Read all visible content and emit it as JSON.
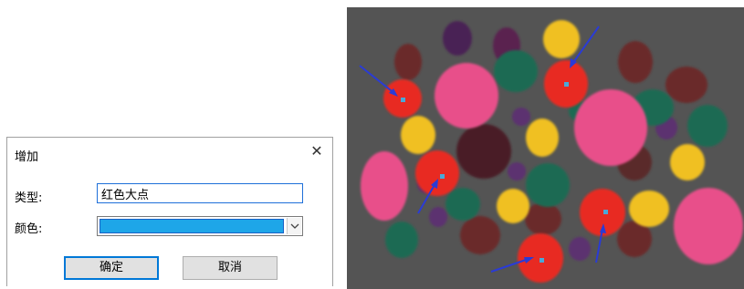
{
  "dialog": {
    "title": "增加",
    "close_icon": "close-icon",
    "type_label": "类型:",
    "type_value": "红色大点",
    "color_label": "颜色:",
    "color_value": "#1ea6e8",
    "ok_label": "确定",
    "cancel_label": "取消"
  },
  "image": {
    "description_icon": "dots-image",
    "marker_color": "#2a3bd6",
    "marker_point_color": "#4aa8d8"
  }
}
